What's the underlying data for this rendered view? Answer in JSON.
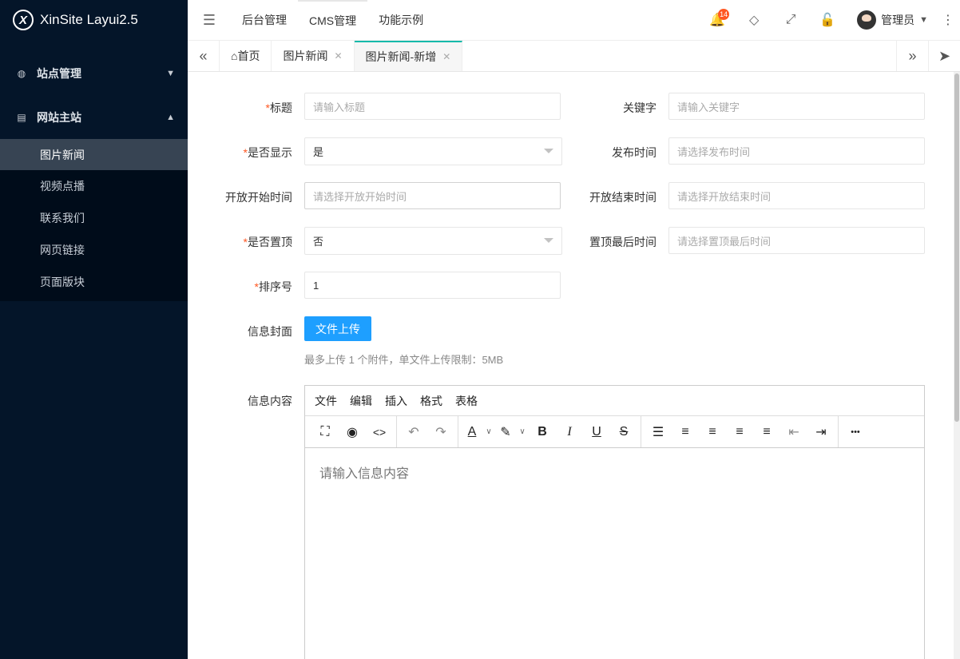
{
  "app": {
    "title": "XinSite Layui2.5",
    "logo_mark": "X"
  },
  "sidebar": {
    "groups": [
      {
        "label": "站点管理",
        "icon": "globe-icon",
        "icon_glyph": "◍",
        "caret": "▼"
      },
      {
        "label": "网站主站",
        "icon": "document-icon",
        "icon_glyph": "▤",
        "caret": "▲"
      }
    ],
    "items": [
      "图片新闻",
      "视频点播",
      "联系我们",
      "网页链接",
      "页面版块"
    ],
    "active_item": "图片新闻"
  },
  "header": {
    "fold_glyph": "☰",
    "nav": [
      "后台管理",
      "CMS管理",
      "功能示例"
    ],
    "notification_count": "14",
    "user_name": "管理员",
    "icons": {
      "bell": "🔔",
      "tag": "◇",
      "fullscreen": "⤢",
      "lock": "🔓",
      "more": "⋮",
      "caret": "▼"
    }
  },
  "tabs": {
    "left_arrow": "«",
    "right_arrow": "»",
    "send_glyph": "➤",
    "home_glyph": "⌂",
    "close_glyph": "✕",
    "items": [
      "首页",
      "图片新闻",
      "图片新闻-新增"
    ]
  },
  "form": {
    "title": {
      "label": "标题",
      "placeholder": "请输入标题"
    },
    "keywords": {
      "label": "关键字",
      "placeholder": "请输入关键字"
    },
    "show": {
      "label": "是否显示",
      "value": "是"
    },
    "publish_time": {
      "label": "发布时间",
      "placeholder": "请选择发布时间"
    },
    "open_start": {
      "label": "开放开始时间",
      "placeholder": "请选择开放开始时间"
    },
    "open_end": {
      "label": "开放结束时间",
      "placeholder": "请选择开放结束时间"
    },
    "top": {
      "label": "是否置顶",
      "value": "否"
    },
    "top_end": {
      "label": "置顶最后时间",
      "placeholder": "请选择置顶最后时间"
    },
    "sort": {
      "label": "排序号",
      "value": "1"
    },
    "cover": {
      "label": "信息封面",
      "button": "文件上传",
      "hint": "最多上传 1 个附件，单文件上传限制：5MB"
    },
    "content": {
      "label": "信息内容",
      "placeholder": "请输入信息内容"
    },
    "required_mark": "*"
  },
  "editor": {
    "menus": [
      "文件",
      "编辑",
      "插入",
      "格式",
      "表格"
    ],
    "toolbar": {
      "fullscreen": "⛶",
      "preview": "◉",
      "code": "<>",
      "undo": "↶",
      "redo": "↷",
      "font_color": "A",
      "highlight": "✎",
      "dropdown": "∨",
      "bold": "B",
      "italic": "I",
      "underline": "U",
      "strike": "S",
      "line_height": "☰",
      "align_left": "≡",
      "align_center": "≡",
      "align_right": "≡",
      "justify": "≡",
      "outdent": "⇤",
      "indent": "⇥",
      "more": "•••"
    }
  }
}
